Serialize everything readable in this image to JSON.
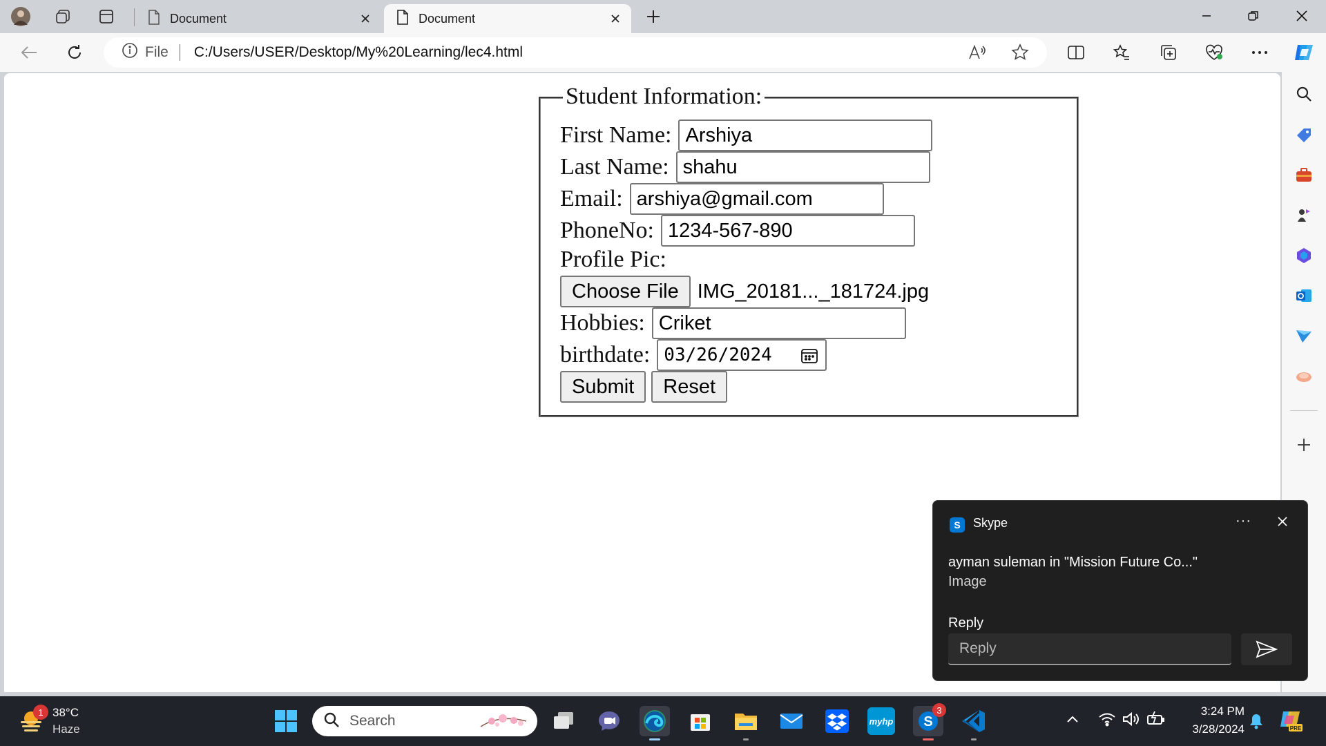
{
  "browser": {
    "tabs": [
      {
        "title": "Document"
      },
      {
        "title": "Document"
      }
    ],
    "address": {
      "scheme_label": "File",
      "url": "C:/Users/USER/Desktop/My%20Learning/lec4.html"
    }
  },
  "form": {
    "legend": "Student Information:",
    "first_name": {
      "label": "First Name:",
      "value": "Arshiya"
    },
    "last_name": {
      "label": "Last Name:",
      "value": "shahu"
    },
    "email": {
      "label": "Email:",
      "value": "arshiya@gmail.com"
    },
    "phone": {
      "label": "PhoneNo:",
      "value": "1234-567-890"
    },
    "profile_pic": {
      "label": "Profile Pic:",
      "button": "Choose File",
      "filename": "IMG_20181..._181724.jpg"
    },
    "hobbies": {
      "label": "Hobbies:",
      "value": "Criket"
    },
    "birthdate": {
      "label": "birthdate:",
      "value": "03/26/2024"
    },
    "submit": "Submit",
    "reset": "Reset"
  },
  "toast": {
    "app": "Skype",
    "title": "ayman suleman in \"Mission Future Co...\"",
    "body": "Image",
    "reply_label": "Reply",
    "reply_placeholder": "Reply",
    "menu_glyph": "···"
  },
  "taskbar": {
    "weather": {
      "temp": "38°C",
      "condition": "Haze",
      "badge": "1"
    },
    "search_placeholder": "Search",
    "skype_badge": "3",
    "myhp_label": "myhp",
    "time": "3:24 PM",
    "date": "3/28/2024"
  },
  "colors": {
    "skype": "#0078d4",
    "copilot": "#1a73e8",
    "vscode": "#0a7ace",
    "taskbar_bg": "#20232a",
    "toast_bg": "#1f1f1f"
  }
}
